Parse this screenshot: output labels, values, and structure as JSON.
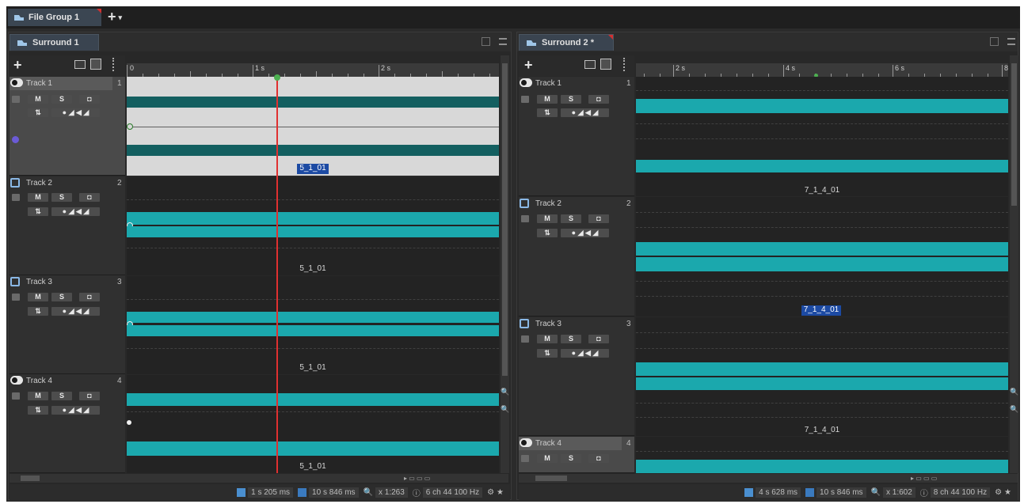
{
  "file_tab": {
    "label": "File Group 1",
    "add_label": "+",
    "add_menu": "▾"
  },
  "panels": [
    {
      "tab_label": "Surround 1",
      "add_label": "+",
      "clip_label": "5_1_01",
      "tracks": [
        {
          "name": "Track 1",
          "number": "1"
        },
        {
          "name": "Track 2",
          "number": "2"
        },
        {
          "name": "Track 3",
          "number": "3"
        },
        {
          "name": "Track 4",
          "number": "4"
        }
      ],
      "ruler_labels": [
        "0",
        "1 s",
        "2 s"
      ],
      "status": {
        "cursor": "1 s 205 ms",
        "length": "10 s 846 ms",
        "zoom": "x 1:263",
        "format": "6 ch 44 100 Hz"
      }
    },
    {
      "tab_label": "Surround 2 *",
      "add_label": "+",
      "clip_label": "7_1_4_01",
      "tracks": [
        {
          "name": "Track 1",
          "number": "1"
        },
        {
          "name": "Track 2",
          "number": "2"
        },
        {
          "name": "Track 3",
          "number": "3"
        },
        {
          "name": "Track 4",
          "number": "4"
        }
      ],
      "ruler_labels": [
        "2 s",
        "4 s",
        "6 s",
        "8"
      ],
      "status": {
        "cursor": "4 s 628 ms",
        "length": "10 s 846 ms",
        "zoom": "x 1:602",
        "format": "8 ch 44 100 Hz"
      }
    }
  ],
  "track_buttons": {
    "mute": "M",
    "solo": "S"
  },
  "colors": {
    "waveform": "#1ba8ad",
    "waveform_dark": "#135f60",
    "cursor": "#e03030",
    "selection_label": "#1c4aa3"
  }
}
